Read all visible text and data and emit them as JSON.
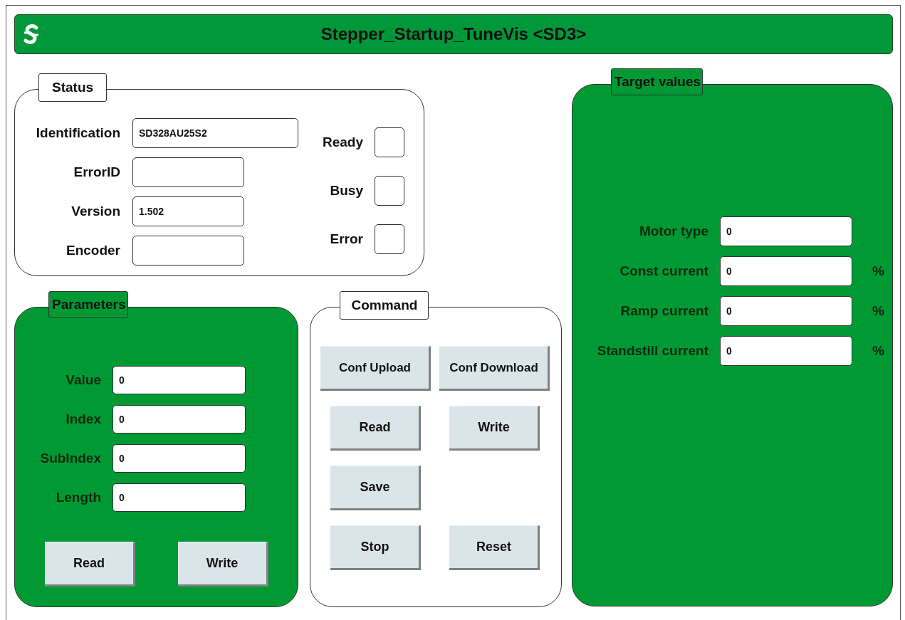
{
  "title_bar": {
    "title": "Stepper_Startup_TuneVis <SD3>"
  },
  "status": {
    "legend": "Status",
    "fields": [
      {
        "label": "Identification",
        "value": "SD328AU25S2",
        "kind": "wide"
      },
      {
        "label": "ErrorID",
        "kind": "narrow"
      },
      {
        "label": "Version",
        "value": "1.502",
        "kind": "narrow"
      },
      {
        "label": "Encoder",
        "kind": "narrow"
      }
    ],
    "indicators": [
      {
        "label": "Ready",
        "checked": false
      },
      {
        "label": "Busy",
        "checked": false
      },
      {
        "label": "Error",
        "checked": false
      }
    ]
  },
  "parameters": {
    "legend": "Parameters",
    "fields": [
      {
        "label": "Value",
        "value": "0"
      },
      {
        "label": "Index",
        "value": "0"
      },
      {
        "label": "SubIndex",
        "value": "0"
      },
      {
        "label": "Length",
        "value": "0"
      }
    ],
    "buttons": [
      "Read",
      "Write"
    ]
  },
  "command": {
    "legend": "Command",
    "rows": [
      {
        "buttons": [
          "Conf Upload",
          "Conf Download"
        ]
      },
      {
        "buttons": [
          "Read",
          "Write"
        ]
      },
      {
        "buttons": [
          "Save"
        ]
      },
      {
        "buttons": [
          "Stop",
          "Reset"
        ]
      }
    ]
  },
  "target_values": {
    "legend": "Target values",
    "fields": [
      {
        "label": "Motor type",
        "value": "0"
      },
      {
        "label": "Const current",
        "value": "0",
        "unit": "%"
      },
      {
        "label": "Ramp current",
        "value": "0",
        "unit": "%"
      },
      {
        "label": "Standstill current",
        "value": "0",
        "unit": "%"
      }
    ]
  }
}
